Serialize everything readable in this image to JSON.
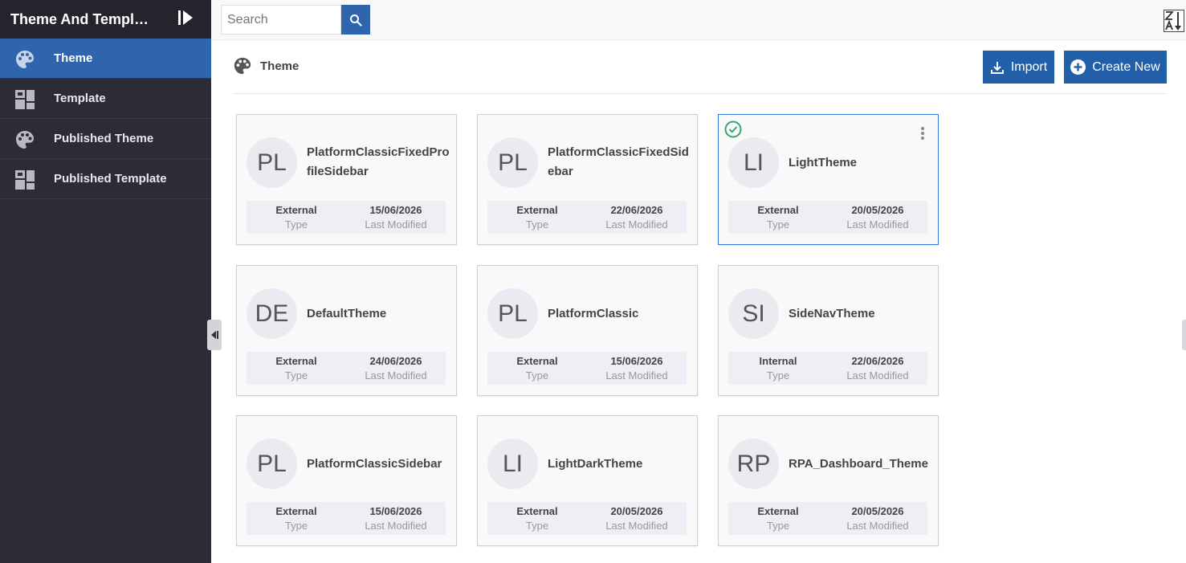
{
  "sidebar": {
    "title": "Theme And Templ…",
    "items": [
      {
        "label": "Theme",
        "icon": "palette-icon",
        "active": true
      },
      {
        "label": "Template",
        "icon": "template-icon",
        "active": false
      },
      {
        "label": "Published Theme",
        "icon": "palette-icon",
        "active": false
      },
      {
        "label": "Published Template",
        "icon": "template-icon",
        "active": false
      }
    ]
  },
  "topbar": {
    "search_placeholder": "Search"
  },
  "header": {
    "title": "Theme",
    "import_label": "Import",
    "create_label": "Create New"
  },
  "meta_labels": {
    "type": "Type",
    "modified": "Last Modified"
  },
  "cards": [
    {
      "initials": "PL",
      "name": "PlatformClassicFixedProfileSidebar",
      "type": "External",
      "modified": "15/06/2026",
      "selected": false
    },
    {
      "initials": "PL",
      "name": "PlatformClassicFixedSidebar",
      "type": "External",
      "modified": "22/06/2026",
      "selected": false
    },
    {
      "initials": "LI",
      "name": "LightTheme",
      "type": "External",
      "modified": "20/05/2026",
      "selected": true
    },
    {
      "initials": "DE",
      "name": "DefaultTheme",
      "type": "External",
      "modified": "24/06/2026",
      "selected": false
    },
    {
      "initials": "PL",
      "name": "PlatformClassic",
      "type": "External",
      "modified": "15/06/2026",
      "selected": false
    },
    {
      "initials": "SI",
      "name": "SideNavTheme",
      "type": "Internal",
      "modified": "22/06/2026",
      "selected": false
    },
    {
      "initials": "PL",
      "name": "PlatformClassicSidebar",
      "type": "External",
      "modified": "15/06/2026",
      "selected": false
    },
    {
      "initials": "LI",
      "name": "LightDarkTheme",
      "type": "External",
      "modified": "20/05/2026",
      "selected": false
    },
    {
      "initials": "RP",
      "name": "RPA_Dashboard_Theme",
      "type": "External",
      "modified": "20/05/2026",
      "selected": false
    }
  ],
  "colors": {
    "accent": "#2f65ad",
    "sidebar_bg": "#2c2c36",
    "selected_border": "#2f7bd5",
    "check_green": "#2eaa6e"
  }
}
